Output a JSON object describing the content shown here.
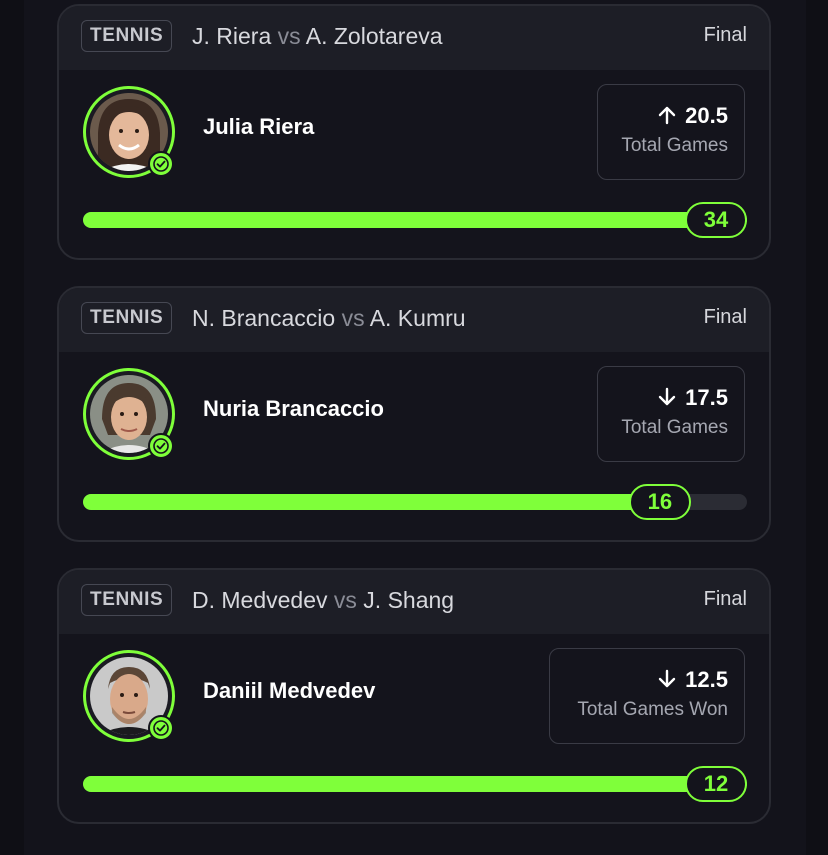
{
  "colors": {
    "accent": "#7fff3a",
    "card_bg": "#14141c",
    "header_bg": "#1d1e26",
    "track": "#2b2c34"
  },
  "cards": [
    {
      "sport": "TENNIS",
      "player_a": "J. Riera",
      "vs": "vs",
      "player_b": "A. Zolotareva",
      "status": "Final",
      "player_name": "Julia Riera",
      "direction": "up",
      "line": "20.5",
      "stat": "Total Games",
      "result": "34",
      "progress_fraction": 1.0
    },
    {
      "sport": "TENNIS",
      "player_a": "N. Brancaccio",
      "vs": "vs",
      "player_b": "A. Kumru",
      "status": "Final",
      "player_name": "Nuria Brancaccio",
      "direction": "down",
      "line": "17.5",
      "stat": "Total Games",
      "result": "16",
      "progress_fraction": 0.914
    },
    {
      "sport": "TENNIS",
      "player_a": "D. Medvedev",
      "vs": "vs",
      "player_b": "J. Shang",
      "status": "Final",
      "player_name": "Daniil Medvedev",
      "direction": "down",
      "line": "12.5",
      "stat": "Total Games Won",
      "result": "12",
      "progress_fraction": 1.0
    }
  ]
}
